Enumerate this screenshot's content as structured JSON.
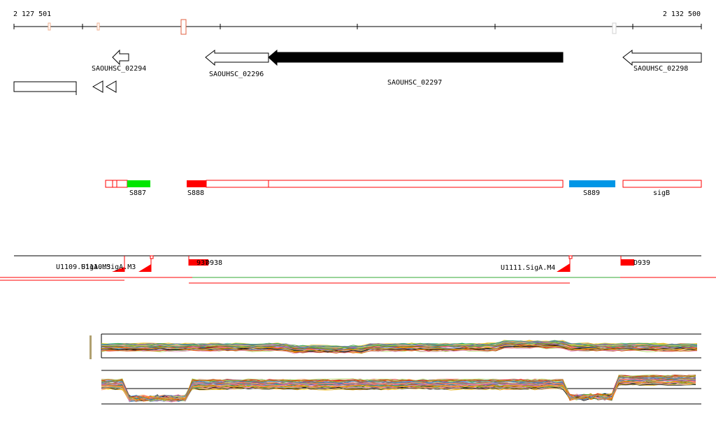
{
  "axis": {
    "start_label": "2 127 501",
    "end_label": "2 132 500"
  },
  "genes": [
    {
      "id": "SAOUHSC_02294",
      "label": "SAOUHSC_02294"
    },
    {
      "id": "SAOUHSC_02296",
      "label": "SAOUHSC_02296"
    },
    {
      "id": "SAOUHSC_02297",
      "label": "SAOUHSC_02297"
    },
    {
      "id": "SAOUHSC_02298",
      "label": "SAOUHSC_02298"
    }
  ],
  "segments": [
    {
      "id": "S887",
      "label": "S887",
      "color": "#00e600"
    },
    {
      "id": "S888",
      "label": "S888",
      "color": "#ff0000"
    },
    {
      "id": "S889",
      "label": "S889",
      "color": "#0096e6"
    },
    {
      "id": "sigB",
      "label": "sigB",
      "color": "#ff0000"
    }
  ],
  "transcription_units": [
    {
      "id": "U1109",
      "label": "U1109.SigA.M3"
    },
    {
      "id": "U1110",
      "label": "U1110.SigA.M3"
    },
    {
      "id": "U1111",
      "label": "U1111.SigA.M4"
    }
  ],
  "features": [
    {
      "id": "937",
      "label": "937"
    },
    {
      "id": "D938",
      "label": "D938"
    },
    {
      "id": "D939",
      "label": "D939"
    }
  ],
  "colors": {
    "outline": "#ff0000",
    "terminator": "#ff0000",
    "green_line": "#33aa33",
    "track_line": "#000000"
  }
}
